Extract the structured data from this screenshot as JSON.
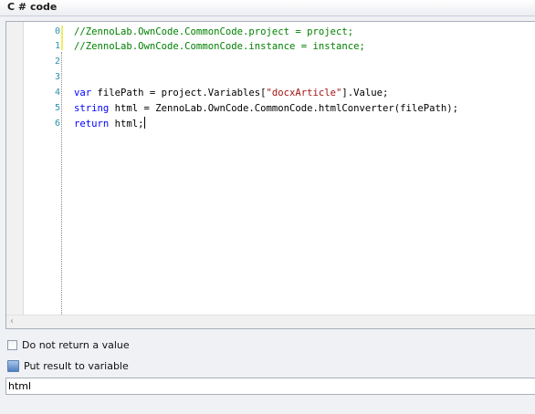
{
  "panel": {
    "title": "C # code"
  },
  "editor": {
    "lines": [
      {
        "number": "0",
        "text": "//ZennoLab.OwnCode.CommonCode.project = project;"
      },
      {
        "number": "1",
        "text": "//ZennoLab.OwnCode.CommonCode.instance = instance;"
      },
      {
        "number": "2",
        "text": ""
      },
      {
        "number": "3",
        "text": ""
      },
      {
        "number": "4",
        "text": "var filePath = project.Variables[\"docxArticle\"].Value;"
      },
      {
        "number": "5",
        "text": "string html = ZennoLab.OwnCode.CommonCode.htmlConverter(filePath);"
      },
      {
        "number": "6",
        "text": "return html;"
      }
    ],
    "tokens": {
      "l4_kw": "var",
      "l4_a": " filePath = project.Variables[",
      "l4_str": "\"docxArticle\"",
      "l4_b": "].Value;",
      "l5_kw": "string",
      "l5_a": " html = ZennoLab.OwnCode.CommonCode.htmlConverter(filePath);",
      "l6_kw": "return",
      "l6_a": " html;"
    },
    "colors": {
      "comment": "#008000",
      "keyword": "#0000ff",
      "string": "#a31515",
      "line_number": "#2b91af"
    }
  },
  "options": {
    "do_not_return_label": "Do not return a value",
    "do_not_return_checked": false,
    "put_result_label": "Put result to variable",
    "result_variable_value": "html"
  },
  "icons": {
    "scroll_left": "chevron-left-icon",
    "variable": "variable-icon"
  }
}
